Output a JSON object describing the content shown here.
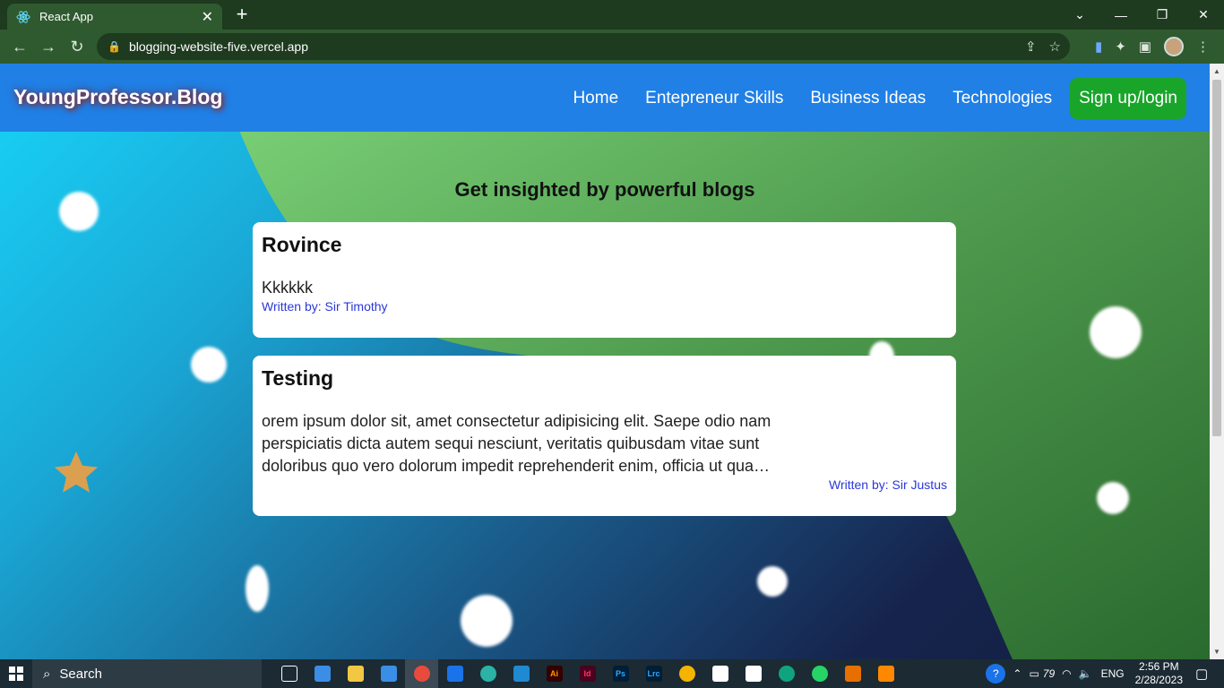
{
  "browser": {
    "tab_title": "React App",
    "url": "blogging-website-five.vercel.app"
  },
  "site": {
    "brand": "YoungProfessor.Blog",
    "nav": [
      "Home",
      "Entepreneur Skills",
      "Business Ideas",
      "Technologies"
    ],
    "signup": "Sign up/login",
    "heading": "Get insighted by powerful blogs"
  },
  "posts": [
    {
      "title": "Rovince",
      "body": "Kkkkkk",
      "author": "Written by: Sir Timothy"
    },
    {
      "title": "Testing",
      "body": "orem ipsum dolor sit, amet consectetur adipisicing elit. Saepe odio nam perspiciatis dicta autem sequi nesciunt, veritatis quibusdam vitae sunt doloribus quo vero dolorum impedit reprehenderit enim, officia ut qua…",
      "author": "Written by: Sir Justus"
    }
  ],
  "taskbar": {
    "search_label": "Search",
    "apps": [
      "Task View",
      "Store",
      "File Explorer",
      "Mail",
      "Chrome",
      "Wallet",
      "Edge",
      "VS Code",
      "Ai",
      "Id",
      "Ps",
      "Lrc",
      "Drive",
      "App",
      "App",
      "ChatGPT",
      "WhatsApp",
      "Java",
      "VLC"
    ],
    "lang": "ENG",
    "battery": "79",
    "time": "2:56 PM",
    "date": "2/28/2023"
  },
  "colors": {
    "header_bg": "#2080e6",
    "signup_bg": "#19a52a",
    "author_link": "#2a38d8"
  }
}
